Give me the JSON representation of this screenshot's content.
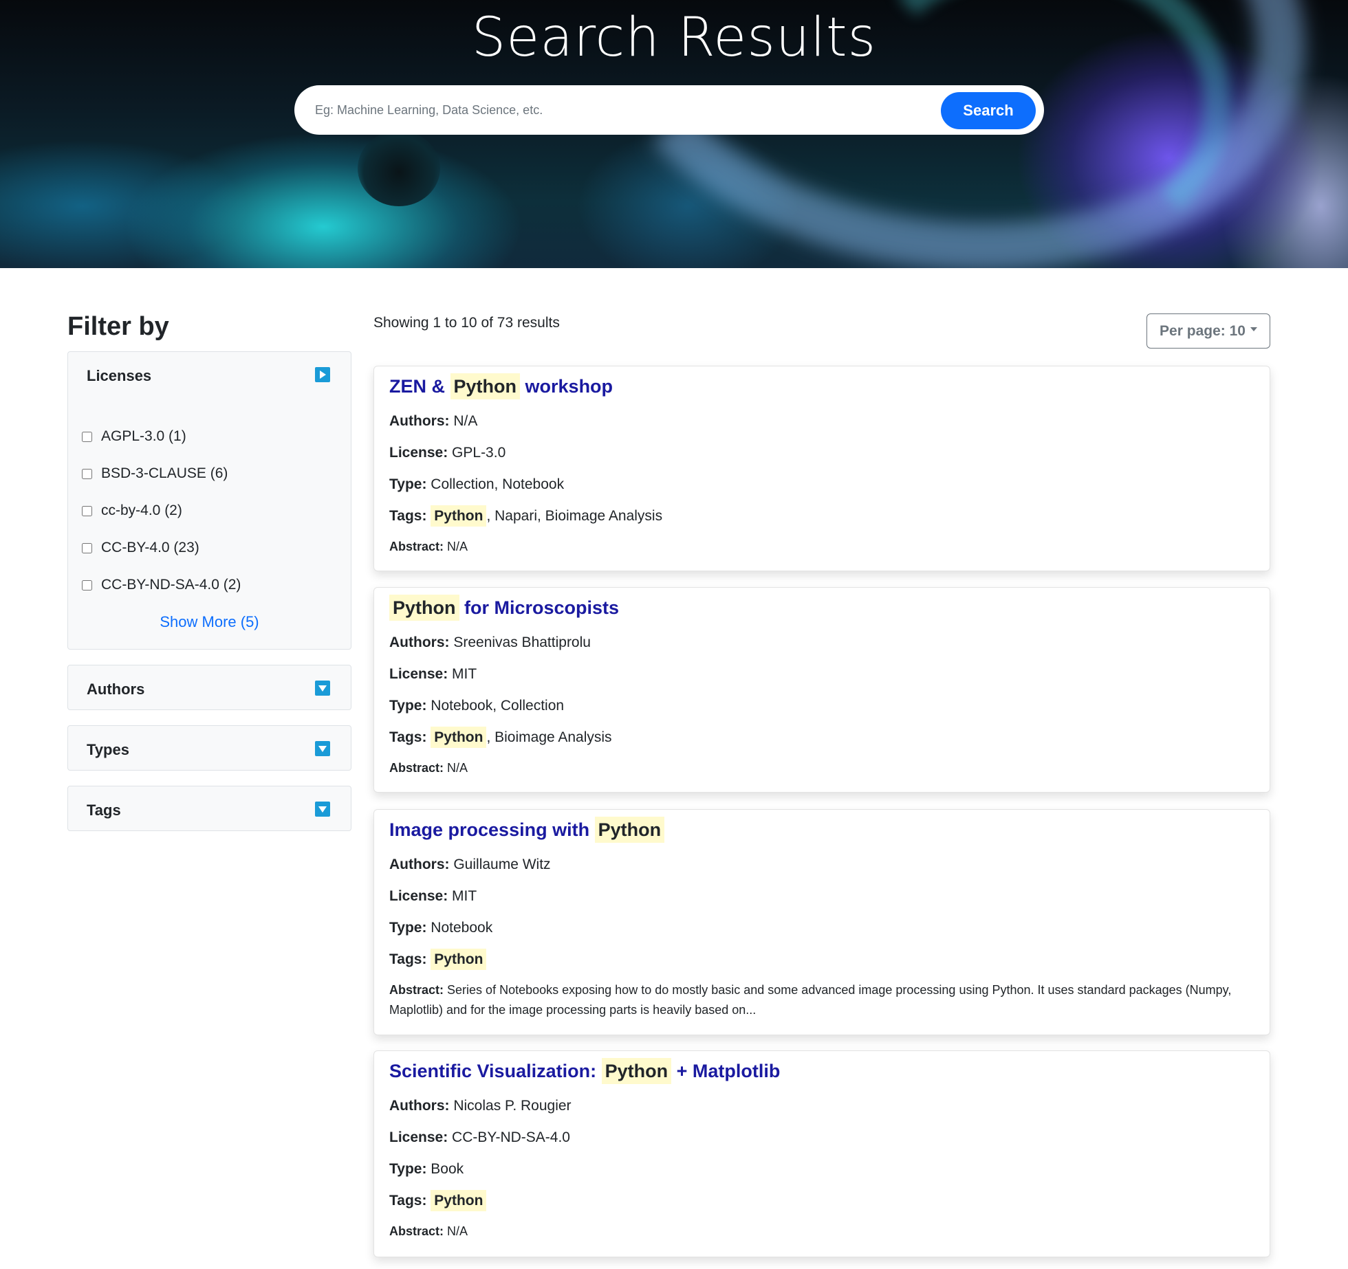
{
  "hero": {
    "title": "Search Results",
    "search_placeholder": "Eg: Machine Learning, Data Science, etc.",
    "search_button": "Search"
  },
  "sidebar": {
    "title": "Filter by",
    "licenses": {
      "label": "Licenses",
      "items": [
        {
          "label": "AGPL-3.0 (1)"
        },
        {
          "label": "BSD-3-CLAUSE (6)"
        },
        {
          "label": "cc-by-4.0 (2)"
        },
        {
          "label": "CC-BY-4.0 (23)"
        },
        {
          "label": "CC-BY-ND-SA-4.0 (2)"
        }
      ],
      "show_more": "Show More (5)"
    },
    "authors": {
      "label": "Authors"
    },
    "types": {
      "label": "Types"
    },
    "tags": {
      "label": "Tags"
    },
    "toggle_icon_color": "#1a9bd7"
  },
  "results": {
    "summary": "Showing 1 to 10 of 73 results",
    "per_page": "Per page: 10",
    "labels": {
      "authors": "Authors:",
      "license": "License:",
      "type": "Type:",
      "tags": "Tags:",
      "abstract": "Abstract:"
    },
    "highlight_color": "#fffacd",
    "title_color": "#1a1aa0",
    "items": [
      {
        "title_pre": "ZEN &",
        "title_hl": "Python",
        "title_post": "workshop",
        "authors": "N/A",
        "license": "GPL-3.0",
        "type": "Collection, Notebook",
        "tag_hl": "Python",
        "tags_rest": ", Napari, Bioimage Analysis",
        "abstract": "N/A"
      },
      {
        "title_pre": "",
        "title_hl": "Python",
        "title_post": "for Microscopists",
        "authors": "Sreenivas Bhattiprolu",
        "license": "MIT",
        "type": "Notebook, Collection",
        "tag_hl": "Python",
        "tags_rest": ", Bioimage Analysis",
        "abstract": "N/A"
      },
      {
        "title_pre": "Image processing with",
        "title_hl": "Python",
        "title_post": "",
        "authors": "Guillaume Witz",
        "license": "MIT",
        "type": "Notebook",
        "tag_hl": "Python",
        "tags_rest": "",
        "abstract": "Series of Notebooks exposing how to do mostly basic and some advanced image processing using Python. It uses standard packages (Numpy, Maplotlib) and for the image processing parts is heavily based on..."
      },
      {
        "title_pre": "Scientific Visualization:",
        "title_hl": "Python",
        "title_post": "+ Matplotlib",
        "authors": "Nicolas P. Rougier",
        "license": "CC-BY-ND-SA-4.0",
        "type": "Book",
        "tag_hl": "Python",
        "tags_rest": "",
        "abstract": "N/A"
      }
    ]
  }
}
